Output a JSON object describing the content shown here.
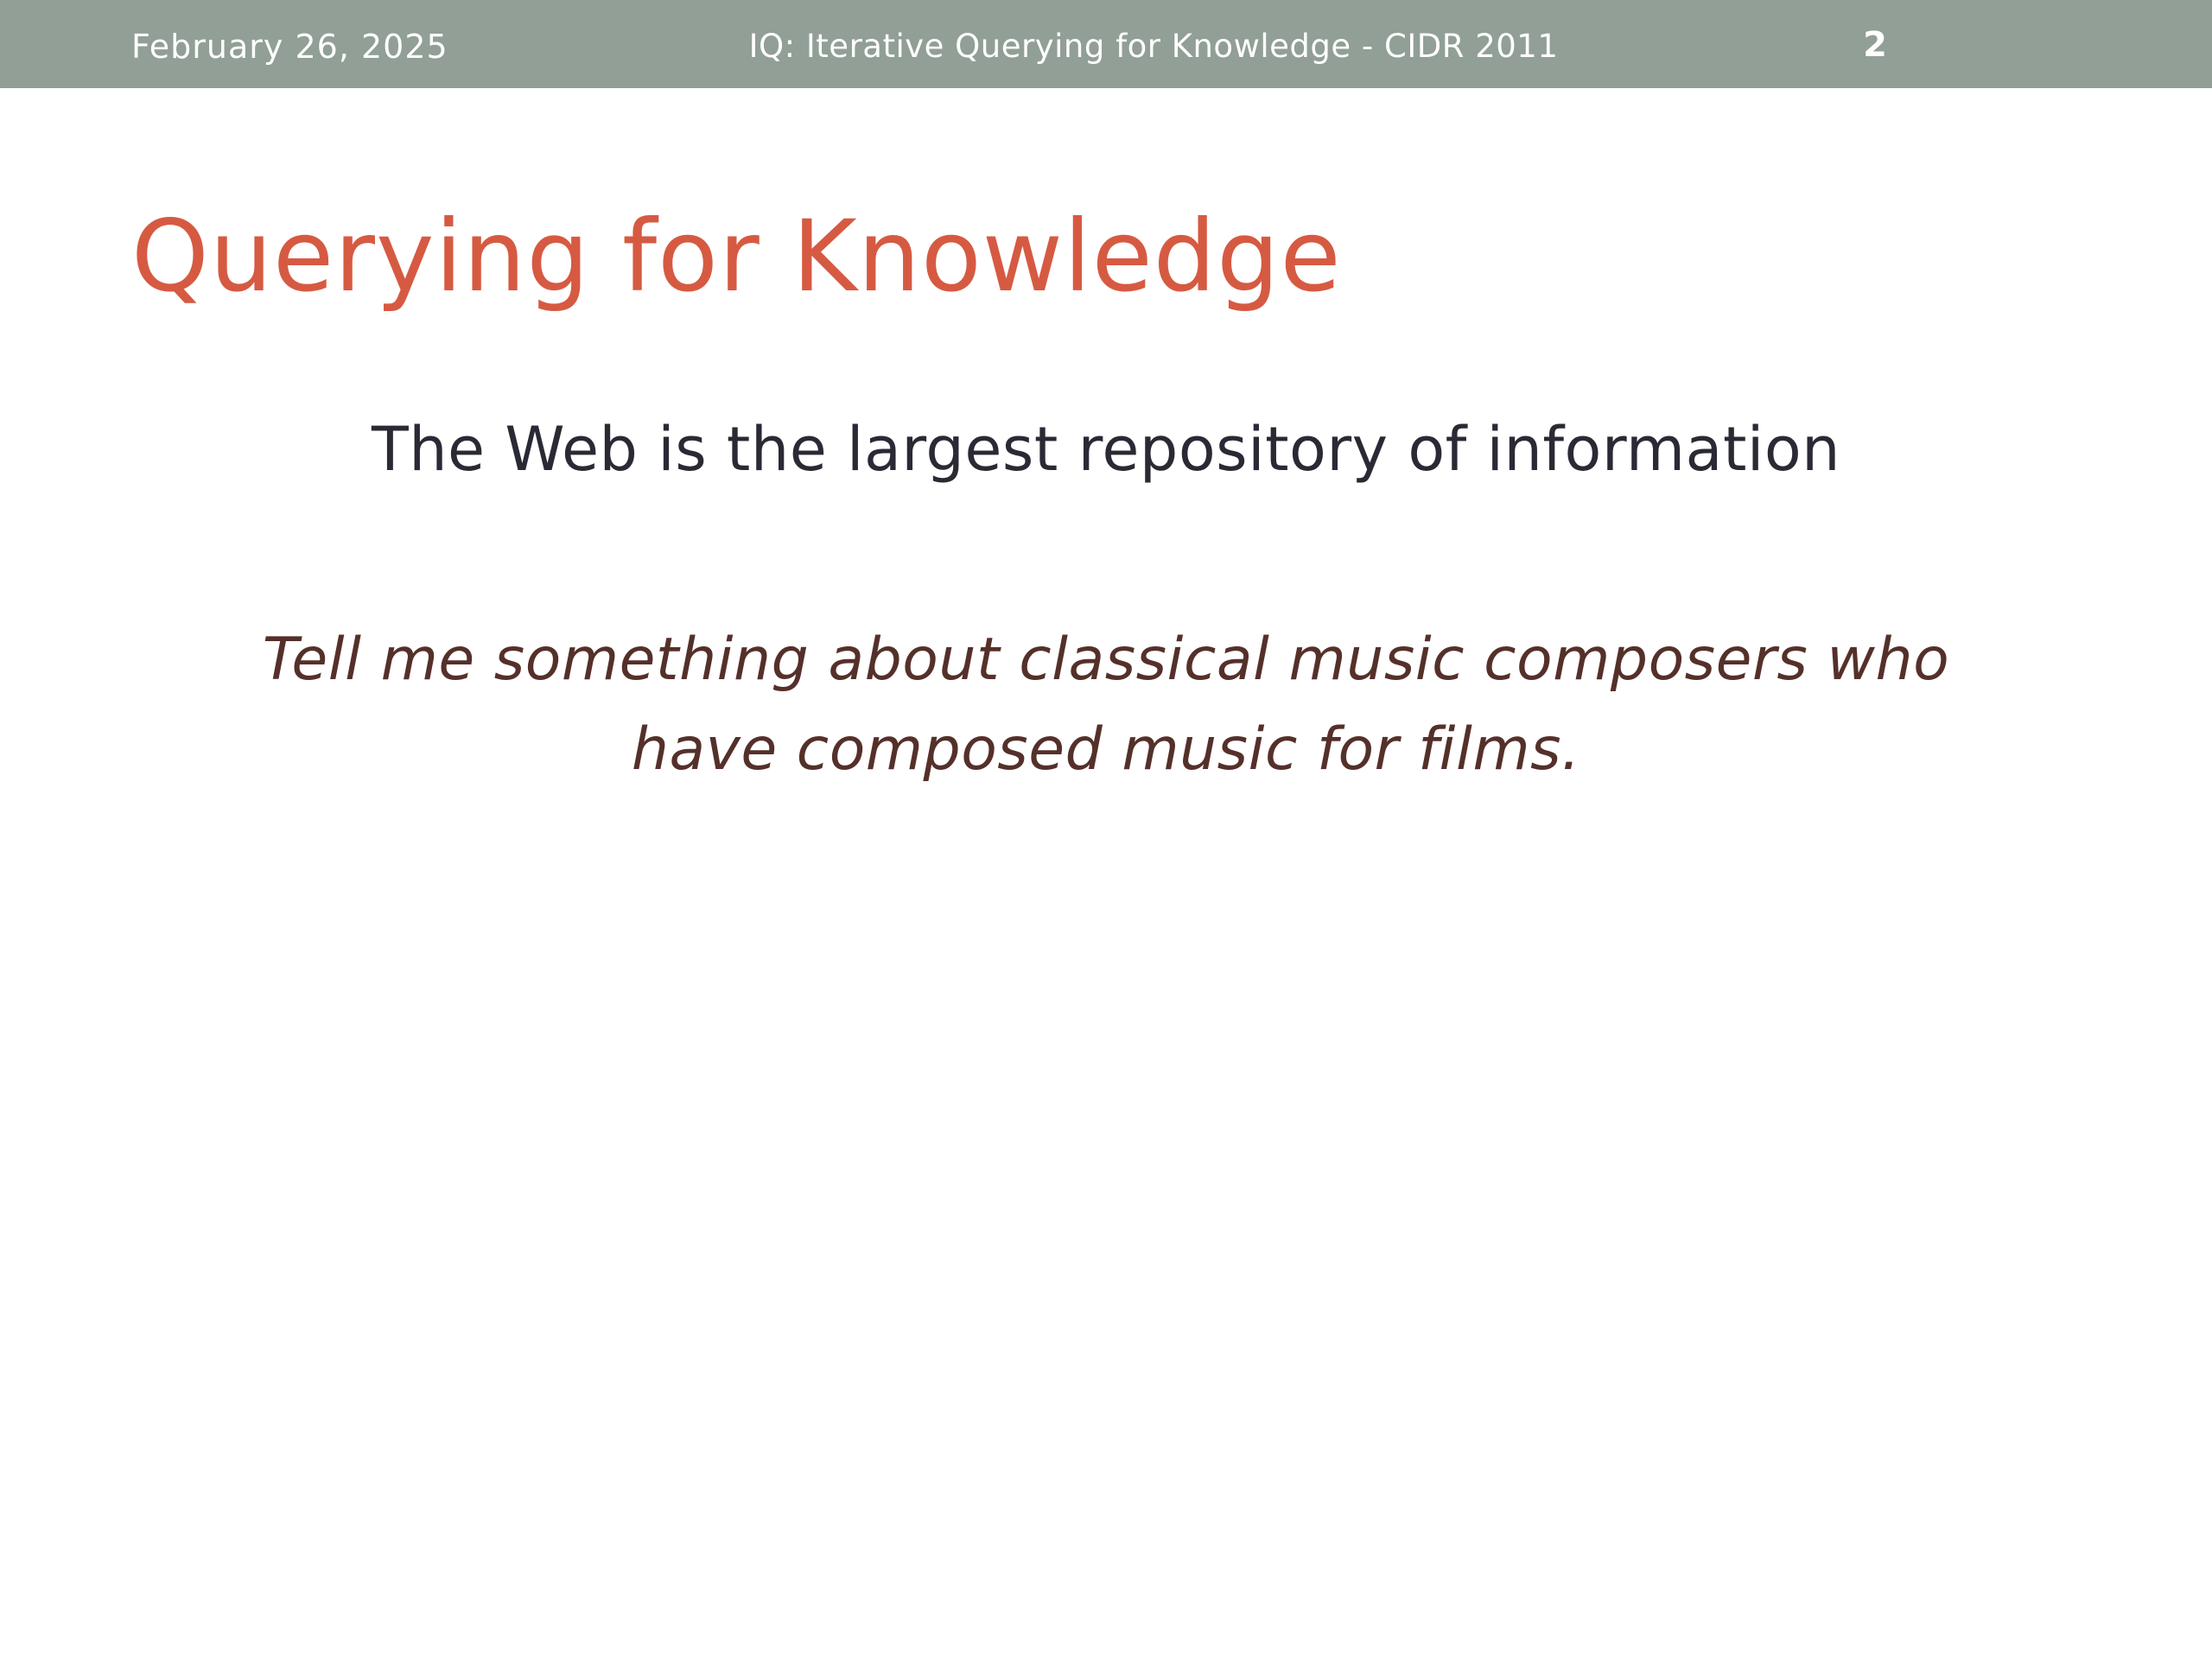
{
  "header": {
    "date": "February 26, 2025",
    "presentation_title": "IQ: Iterative Querying for Knowledge - CIDR 2011",
    "page_number": "2"
  },
  "slide": {
    "title": "Querying for Knowledge",
    "statement": "The Web is the largest repository of information",
    "example_query": "Tell me something about classical music composers who have composed music for films."
  },
  "colors": {
    "header_bar": "#919f96",
    "header_text": "#ffffff",
    "title": "#d65a42",
    "statement": "#2a2a35",
    "example_query": "#55302a",
    "background": "#ffffff"
  }
}
